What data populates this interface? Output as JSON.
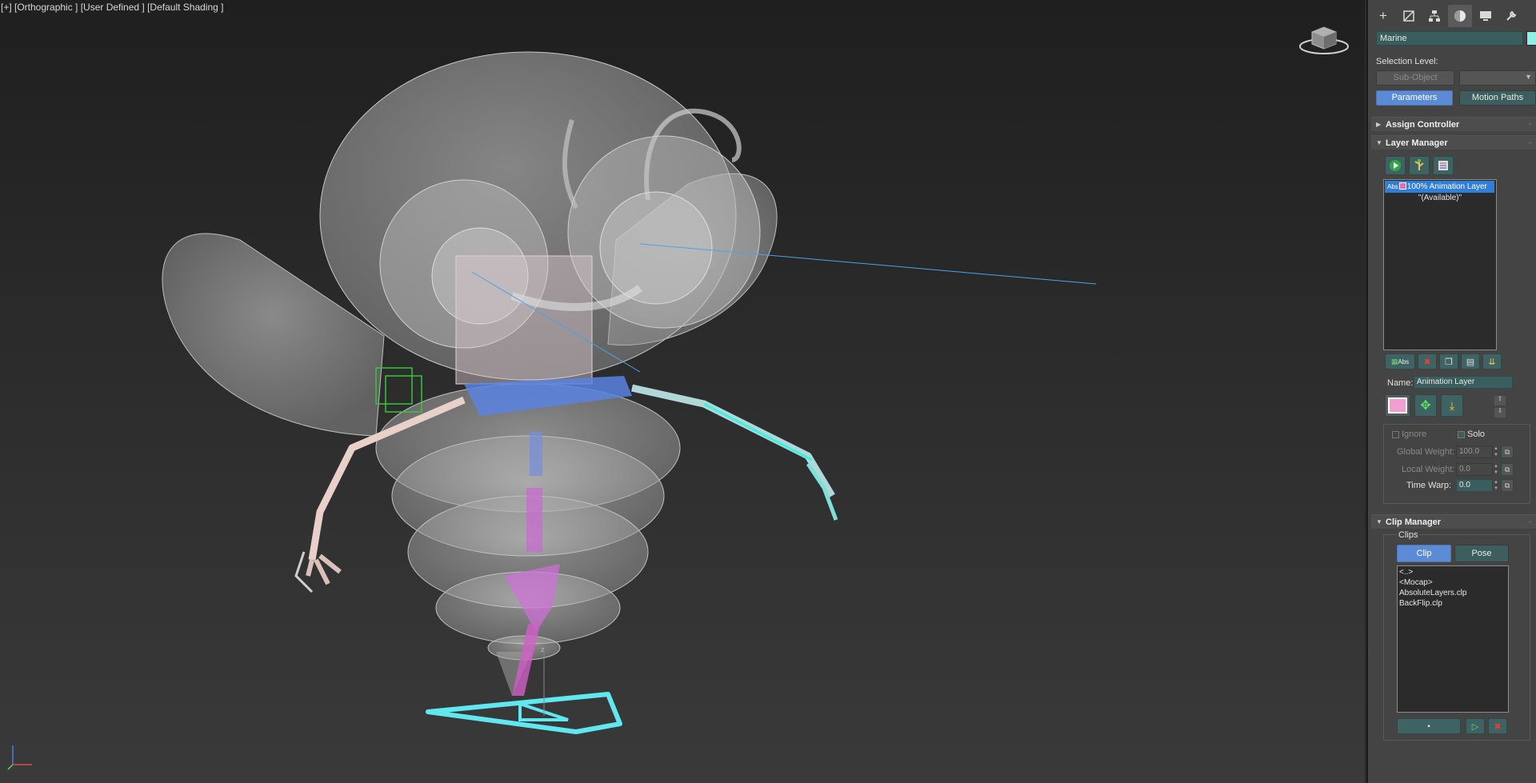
{
  "viewport": {
    "label": "[+] [Orthographic ] [User Defined ] [Default Shading ]"
  },
  "colors": {
    "accent_blue": "#5b8bd5",
    "selection_blue": "#2f7ed8",
    "teal_field": "#3a5e5e",
    "object_color": "#8ff0e6",
    "layer_color": "#e070b0"
  },
  "command_panel": {
    "tabs": [
      {
        "icon": "create-plus-icon",
        "glyph": "+"
      },
      {
        "icon": "modify-icon",
        "glyph": "◺"
      },
      {
        "icon": "hierarchy-icon",
        "glyph": "⊞"
      },
      {
        "icon": "motion-icon",
        "glyph": "●"
      },
      {
        "icon": "display-icon",
        "glyph": "▬"
      },
      {
        "icon": "utilities-icon",
        "glyph": "🔧"
      }
    ],
    "active_tab": "motion-icon",
    "object_name": "Marine",
    "selection_level_label": "Selection Level:",
    "sub_object_label": "Sub-Object",
    "parameters_label": "Parameters",
    "motion_paths_label": "Motion Paths"
  },
  "assign_controller": {
    "title": "Assign Controller"
  },
  "layer_manager": {
    "title": "Layer Manager",
    "toolbar_icons": [
      "play-icon",
      "tree-icon",
      "list-edit-icon"
    ],
    "layers": [
      {
        "abs": "Abs",
        "weight": "100%",
        "name": "Animation Layer",
        "selected": true
      }
    ],
    "available_text": "\"(Available)\"",
    "bottom_icons": [
      "new-abs-layer-icon",
      "delete-icon",
      "copy-icon",
      "paste-icon",
      "collapse-icon"
    ],
    "new_layer_label": "Abs",
    "name_label": "Name:",
    "name_value": "Animation Layer",
    "ignore_label": "Ignore",
    "solo_label": "Solo",
    "global_weight_label": "Global Weight:",
    "global_weight_value": "100.0",
    "local_weight_label": "Local Weight:",
    "local_weight_value": "0.0",
    "time_warp_label": "Time Warp:",
    "time_warp_value": "0.0"
  },
  "clip_manager": {
    "title": "Clip Manager",
    "clips_group_label": "Clips",
    "clip_tab": "Clip",
    "pose_tab": "Pose",
    "items": [
      "<..>",
      "<Mocap>",
      "AbsoluteLayers.clp",
      "BackFlip.clp"
    ]
  }
}
